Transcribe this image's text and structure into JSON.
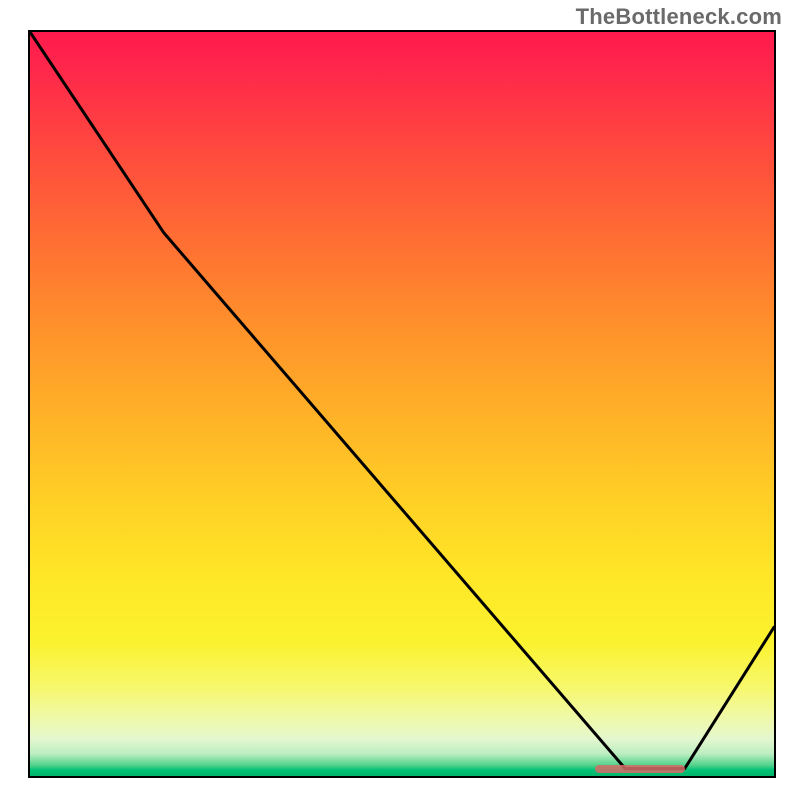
{
  "watermark": "TheBottleneck.com",
  "chart_data": {
    "type": "line",
    "title": "",
    "xlabel": "",
    "ylabel": "",
    "xlim": [
      0,
      100
    ],
    "ylim": [
      0,
      100
    ],
    "series": [
      {
        "name": "curve",
        "x": [
          0,
          18,
          80,
          88,
          100
        ],
        "values": [
          100,
          73,
          1,
          1,
          20
        ]
      }
    ],
    "annotations": [
      {
        "name": "marker",
        "x_start": 76,
        "x_end": 88,
        "y": 1
      }
    ],
    "gradient_stops": [
      {
        "pos": 0,
        "color": "#ff1a4d"
      },
      {
        "pos": 0.5,
        "color": "#ffb327"
      },
      {
        "pos": 0.82,
        "color": "#fbf22e"
      },
      {
        "pos": 0.97,
        "color": "#bdeec2"
      },
      {
        "pos": 1.0,
        "color": "#00b46b"
      }
    ]
  }
}
